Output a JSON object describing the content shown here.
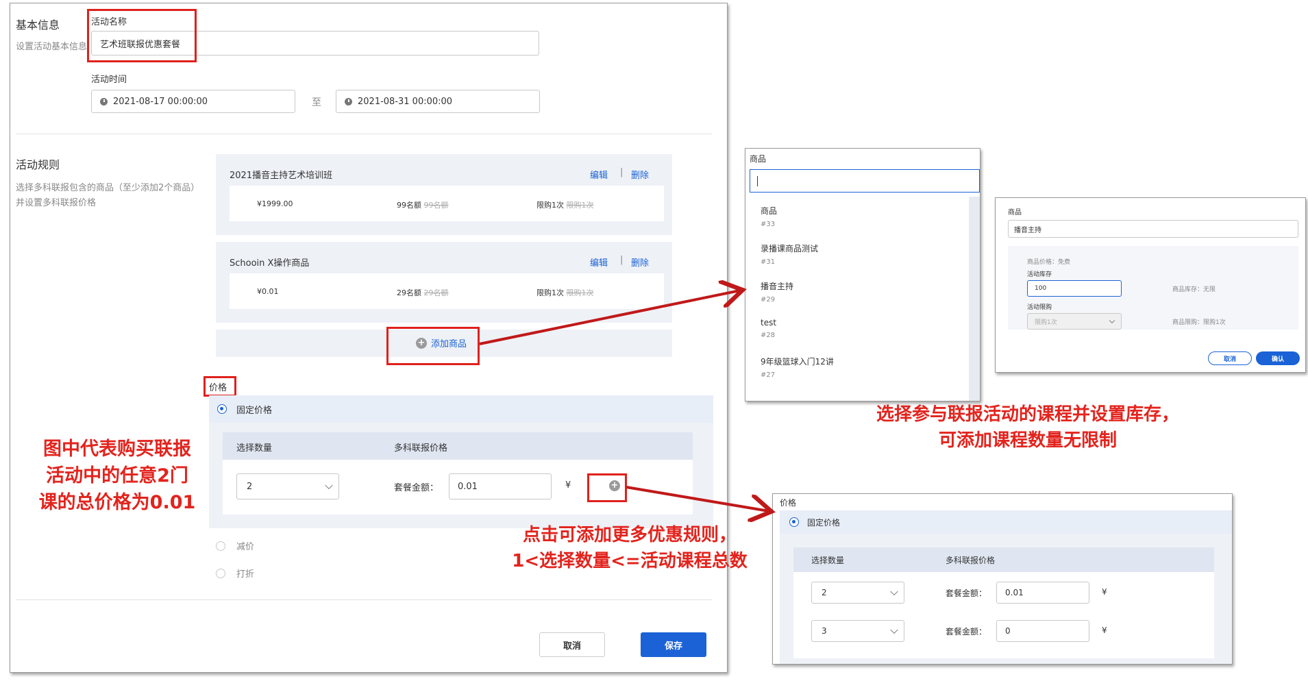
{
  "main": {
    "basic": {
      "section_title": "基本信息",
      "section_desc": "设置活动基本信息",
      "name_label": "活动名称",
      "name_value": "艺术班联报优惠套餐",
      "time_label": "活动时间",
      "start_time": "2021-08-17 00:00:00",
      "to_text": "至",
      "end_time": "2021-08-31 00:00:00"
    },
    "rules": {
      "section_title": "活动规则",
      "desc_line1": "选择多科联报包含的商品（至少添加2个商品）",
      "desc_line2": "并设置多科联报价格",
      "items": [
        {
          "name": "2021播音主持艺术培训班",
          "edit": "编辑",
          "sep": "|",
          "delete": "删除",
          "price": "¥1999.00",
          "quota": "99名额",
          "quota_old": "99名额",
          "limit": "限购1次",
          "limit_old": "限购1次"
        },
        {
          "name": "Schooin X操作商品",
          "edit": "编辑",
          "sep": "|",
          "delete": "删除",
          "price": "¥0.01",
          "quota": "29名额",
          "quota_old": "29名额",
          "limit": "限购1次",
          "limit_old": "限购1次"
        }
      ],
      "add_product": "添加商品"
    },
    "price": {
      "label": "价格",
      "fixed": "固定价格",
      "col_qty": "选择数量",
      "col_price": "多科联报价格",
      "qty_value": "2",
      "amount_label": "套餐金额：",
      "amount_value": "0.01",
      "currency": "¥",
      "reduce": "减价",
      "discount": "打折"
    },
    "footer": {
      "cancel": "取消",
      "save": "保存"
    }
  },
  "product_dropdown": {
    "title": "商品",
    "options": [
      {
        "name": "商品",
        "id": "#33"
      },
      {
        "name": "录播课商品测试",
        "id": "#31"
      },
      {
        "name": "播音主持",
        "id": "#29"
      },
      {
        "name": "test",
        "id": "#28"
      },
      {
        "name": "9年级篮球入门12讲",
        "id": "#27"
      }
    ]
  },
  "stock_dialog": {
    "title": "商品",
    "product_value": "播音主持",
    "price_info": "商品价格：免费",
    "stock_label": "活动库存",
    "stock_value": "100",
    "stock_info": "商品库存：无限",
    "limit_label": "活动限购",
    "limit_value": "限购1次",
    "limit_info": "商品限购：限购1次",
    "cancel": "取消",
    "confirm": "确认"
  },
  "price_panel": {
    "label": "价格",
    "fixed": "固定价格",
    "col_qty": "选择数量",
    "col_price": "多科联报价格",
    "rows": [
      {
        "qty": "2",
        "amount_label": "套餐金额：",
        "amount": "0.01",
        "currency": "¥"
      },
      {
        "qty": "3",
        "amount_label": "套餐金额：",
        "amount": "0",
        "currency": "¥"
      }
    ]
  },
  "notes": {
    "left": [
      "图中代表购买联报",
      "活动中的任意2门",
      "课的总价格为0.01"
    ],
    "right_top": [
      "选择参与联报活动的课程并设置库存，",
      "可添加课程数量无限制"
    ],
    "middle": [
      "点击可添加更多优惠规则，",
      "1<选择数量<=活动课程总数"
    ]
  },
  "colors": {
    "accent": "#1a62d6",
    "annotation": "#e3231d",
    "card_bg": "#eef1f6"
  }
}
